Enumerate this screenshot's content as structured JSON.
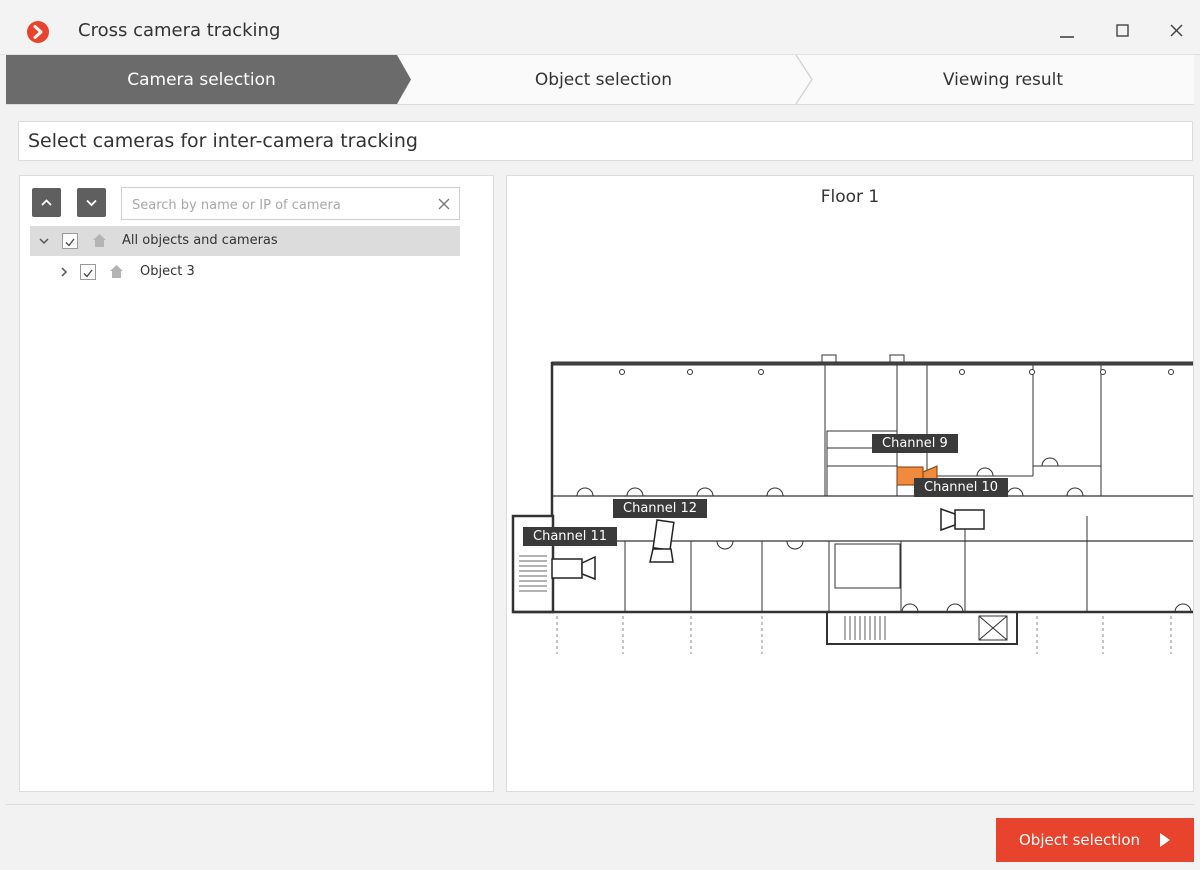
{
  "window": {
    "title": "Cross camera tracking",
    "accent_color": "#e8432d"
  },
  "steps": [
    {
      "label": "Camera selection",
      "active": true
    },
    {
      "label": "Object selection",
      "active": false
    },
    {
      "label": "Viewing result",
      "active": false
    }
  ],
  "page": {
    "heading": "Select cameras for inter-camera tracking"
  },
  "camera_tree": {
    "search_placeholder": "Search by name or IP of camera",
    "items": [
      {
        "label": "All objects and cameras",
        "checked": true,
        "expanded": true,
        "selected": true,
        "icon": "home-icon"
      },
      {
        "label": "Object 3",
        "checked": true,
        "expanded": false,
        "selected": false,
        "icon": "home-icon"
      }
    ]
  },
  "map": {
    "floor_title": "Floor 1",
    "cameras": [
      {
        "label": "Channel 9",
        "highlighted": true
      },
      {
        "label": "Channel 10",
        "highlighted": false
      },
      {
        "label": "Channel 11",
        "highlighted": false
      },
      {
        "label": "Channel 12",
        "highlighted": false
      }
    ],
    "highlight_color": "#f08a3c"
  },
  "footer": {
    "next_button_label": "Object selection"
  }
}
